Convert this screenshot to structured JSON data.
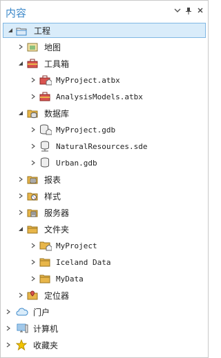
{
  "pane": {
    "title": "内容",
    "buttons": {
      "menu": "▾",
      "pin": "📌",
      "close": "×"
    }
  },
  "tree": [
    {
      "name": "project",
      "label": "工程",
      "icon": "project-folder-icon",
      "expanded": true,
      "selected": true
    },
    {
      "name": "maps",
      "label": "地图",
      "icon": "map-icon",
      "expanded": false
    },
    {
      "name": "toolboxes",
      "label": "工具箱",
      "icon": "toolbox-icon",
      "expanded": true
    },
    {
      "name": "toolbox-myproject",
      "label": "MyProject.atbx",
      "icon": "toolbox-home-icon",
      "expanded": false
    },
    {
      "name": "toolbox-analysis",
      "label": "AnalysisModels.atbx",
      "icon": "toolbox-icon",
      "expanded": false
    },
    {
      "name": "databases",
      "label": "数据库",
      "icon": "database-folder-icon",
      "expanded": true
    },
    {
      "name": "db-myproject",
      "label": "MyProject.gdb",
      "icon": "geodatabase-home-icon",
      "expanded": false
    },
    {
      "name": "db-natural",
      "label": "NaturalResources.sde",
      "icon": "enterprise-database-icon",
      "expanded": false
    },
    {
      "name": "db-urban",
      "label": "Urban.gdb",
      "icon": "geodatabase-icon",
      "expanded": false
    },
    {
      "name": "reports",
      "label": "报表",
      "icon": "report-icon",
      "expanded": false
    },
    {
      "name": "styles",
      "label": "样式",
      "icon": "style-icon",
      "expanded": false
    },
    {
      "name": "servers",
      "label": "服务器",
      "icon": "server-folder-icon",
      "expanded": false
    },
    {
      "name": "folders",
      "label": "文件夹",
      "icon": "folder-icon",
      "expanded": true
    },
    {
      "name": "folder-myproject",
      "label": "MyProject",
      "icon": "home-folder-icon",
      "expanded": false
    },
    {
      "name": "folder-iceland",
      "label": "Iceland Data",
      "icon": "folder-icon",
      "expanded": false
    },
    {
      "name": "folder-mydata",
      "label": "MyData",
      "icon": "folder-icon",
      "expanded": false
    },
    {
      "name": "locators",
      "label": "定位器",
      "icon": "locator-folder-icon",
      "expanded": false
    },
    {
      "name": "portal",
      "label": "门户",
      "icon": "cloud-icon",
      "expanded": false
    },
    {
      "name": "computer",
      "label": "计算机",
      "icon": "computer-icon",
      "expanded": false
    },
    {
      "name": "favorites",
      "label": "收藏夹",
      "icon": "star-icon",
      "expanded": false
    }
  ],
  "colors": {
    "accent": "#3c88c9",
    "selected_bg": "#d9ecfa",
    "selected_border": "#7fb7e3",
    "folder": "#e8b64a"
  }
}
